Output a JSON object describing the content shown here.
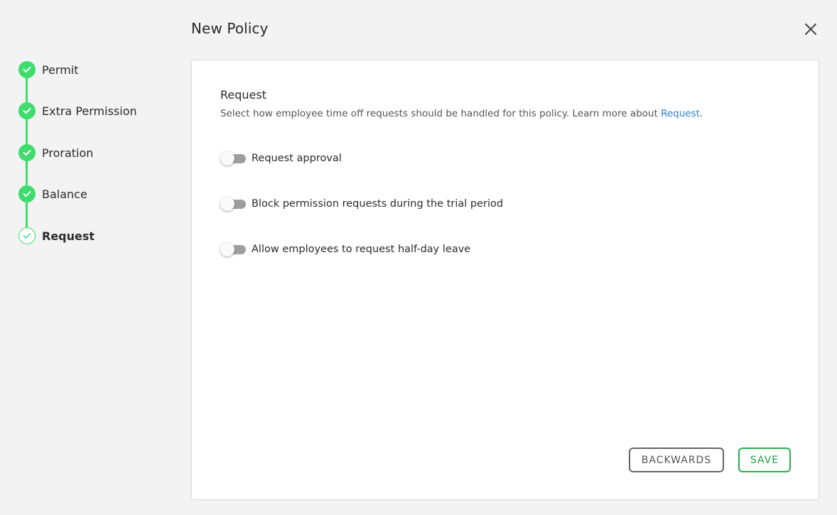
{
  "header": {
    "title": "New Policy",
    "close_icon": "close-icon"
  },
  "colors": {
    "accent_green": "#3ddc6c",
    "link_blue": "#2f7fd1",
    "save_green": "#22b14c"
  },
  "stepper": {
    "steps": [
      {
        "label": "Permit",
        "status": "completed"
      },
      {
        "label": "Extra Permission",
        "status": "completed"
      },
      {
        "label": "Proration",
        "status": "completed"
      },
      {
        "label": "Balance",
        "status": "completed"
      },
      {
        "label": "Request",
        "status": "current"
      }
    ]
  },
  "section": {
    "title": "Request",
    "description_prefix": "Select how employee time off requests should be handled for this policy. Learn more about ",
    "description_link": "Request",
    "description_suffix": "."
  },
  "toggles": [
    {
      "label": "Request approval",
      "on": false
    },
    {
      "label": "Block permission requests during the trial period",
      "on": false
    },
    {
      "label": "Allow employees to request half-day leave",
      "on": false
    }
  ],
  "footer": {
    "back_label": "BACKWARDS",
    "save_label": "SAVE"
  }
}
